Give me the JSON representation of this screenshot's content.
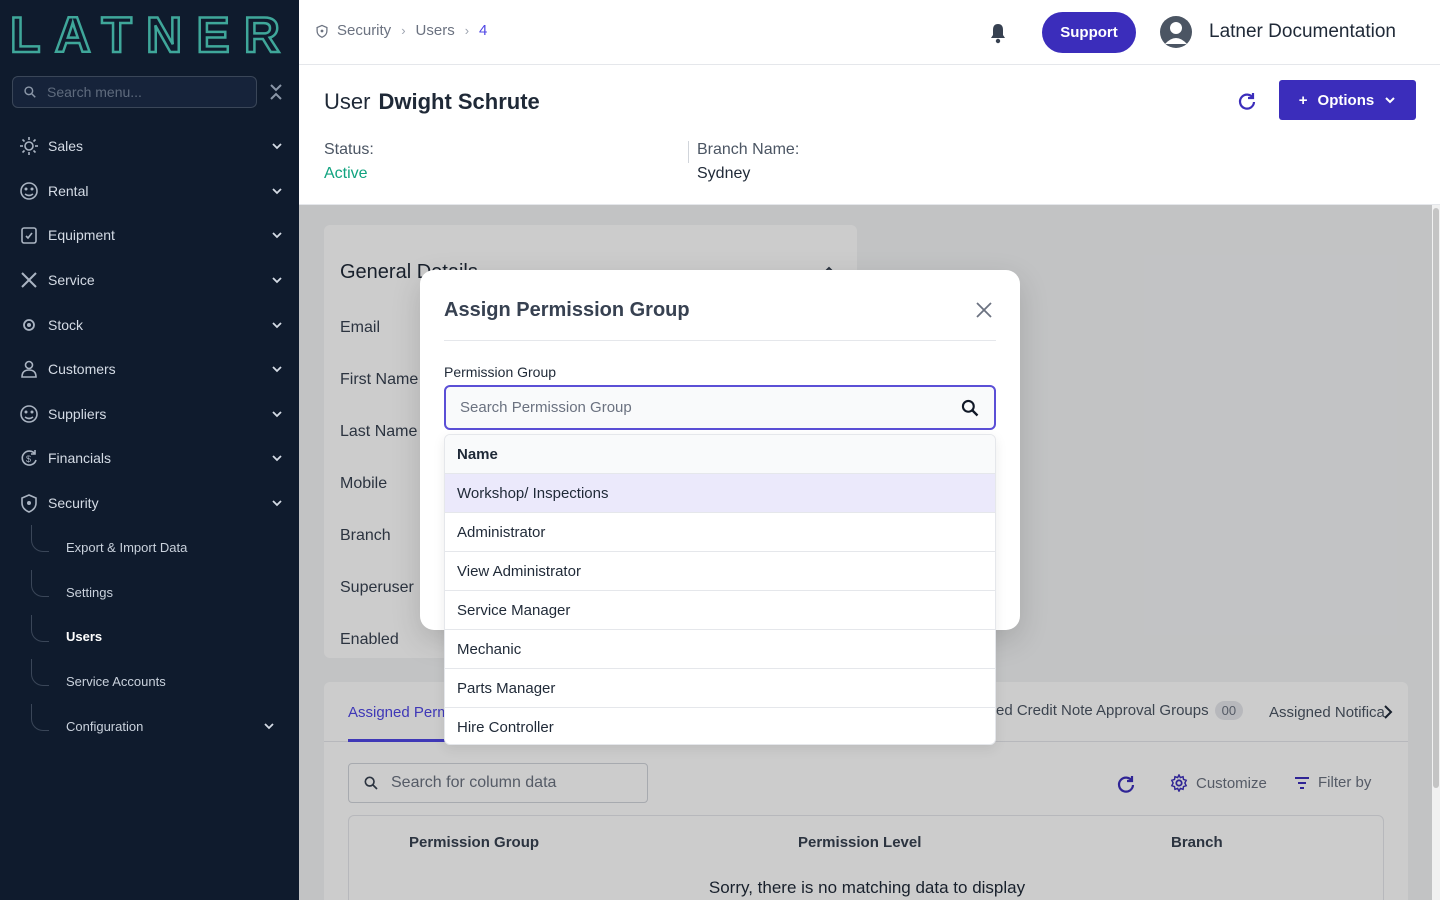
{
  "app": {
    "logo_text": "LATNER",
    "menu_search_placeholder": "Search menu..."
  },
  "sidebar": {
    "items": [
      {
        "label": "Sales",
        "icon": "sales-icon"
      },
      {
        "label": "Rental",
        "icon": "rental-icon"
      },
      {
        "label": "Equipment",
        "icon": "equipment-icon"
      },
      {
        "label": "Service",
        "icon": "service-icon"
      },
      {
        "label": "Stock",
        "icon": "stock-icon"
      },
      {
        "label": "Customers",
        "icon": "customers-icon"
      },
      {
        "label": "Suppliers",
        "icon": "suppliers-icon"
      },
      {
        "label": "Financials",
        "icon": "financials-icon"
      },
      {
        "label": "Security",
        "icon": "shield-icon"
      }
    ],
    "security_sub": [
      {
        "label": "Export & Import Data"
      },
      {
        "label": "Settings"
      },
      {
        "label": "Users"
      },
      {
        "label": "Service Accounts"
      },
      {
        "label": "Configuration"
      }
    ]
  },
  "topbar": {
    "breadcrumb": [
      "Security",
      "Users",
      "4"
    ],
    "support_label": "Support",
    "user_name": "Latner Documentation"
  },
  "header": {
    "title_prefix": "User",
    "title_name": "Dwight Schrute",
    "options_label": "Options",
    "status_label": "Status:",
    "status_value": "Active",
    "branch_label": "Branch Name:",
    "branch_value": "Sydney"
  },
  "general_details": {
    "title": "General Details",
    "fields": [
      "Email",
      "First Name",
      "Last Name",
      "Mobile",
      "Branch",
      "Superuser",
      "Enabled"
    ]
  },
  "tabs": {
    "active_label": "Assigned Perm",
    "credit_label": "ed Credit Note Approval Groups",
    "credit_count": "00",
    "notif_label": "Assigned Notifica"
  },
  "table": {
    "search_placeholder": "Search for column data",
    "customize_label": "Customize",
    "filter_label": "Filter by",
    "columns": [
      "Permission Group",
      "Permission Level",
      "Branch"
    ],
    "empty_message": "Sorry, there is no matching data to display"
  },
  "modal": {
    "title": "Assign Permission Group",
    "field_label": "Permission Group",
    "search_placeholder": "Search Permission Group",
    "list_header": "Name",
    "options": [
      "Workshop/ Inspections",
      "Administrator",
      "View Administrator",
      "Service Manager",
      "Mechanic",
      "Parts Manager",
      "Hire Controller"
    ]
  },
  "colors": {
    "sidebar_bg": "#0f1b2d",
    "accent": "#3b2dbb",
    "status_active": "#10a37f",
    "logo": "#3fa79a"
  }
}
